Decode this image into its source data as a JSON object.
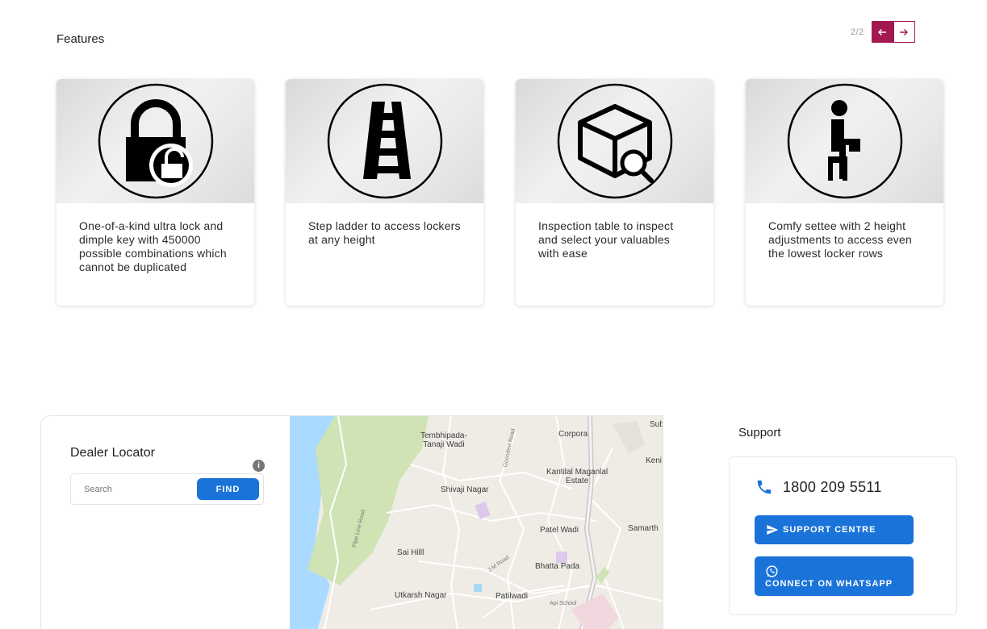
{
  "features": {
    "title": "Features",
    "pager": {
      "count": "2/2",
      "prev_icon": "arrow-left-icon",
      "next_icon": "arrow-right-icon"
    },
    "cards": [
      {
        "icon": "padlock-key-icon",
        "text": "One-of-a-kind ultra lock and dimple key with 450000 possible combinations which cannot be duplicated"
      },
      {
        "icon": "step-ladder-icon",
        "text": "Step ladder to access lockers at any height"
      },
      {
        "icon": "box-inspect-icon",
        "text": "Inspection table to inspect and select your valuables with ease"
      },
      {
        "icon": "seated-person-icon",
        "text": "Comfy settee with 2 height adjustments to access even the lowest locker rows"
      }
    ]
  },
  "dealer_locator": {
    "title": "Dealer Locator",
    "search_placeholder": "Search",
    "find_label": "FIND",
    "info_icon": "info-icon",
    "map_labels": {
      "tembhipada": "Tembhipada-\nTanaji Wadi",
      "corpora": "Corpora",
      "sub": "Sub",
      "keni": "Keni",
      "kantilal": "Kantilal Maganlal\nEstate",
      "shivaji": "Shivaji Nagar",
      "patel": "Patel Wadi",
      "samarth": "Samarth",
      "sai": "Sai Hilll",
      "bhatta": "Bhatta Pada",
      "utkarsh": "Utkarsh Nagar",
      "patilwadi": "Patilwadi",
      "goondevi": "Goondevi Road",
      "pipeline": "Pipe Line Road",
      "jm": "J M Road",
      "api": "Api School"
    }
  },
  "support": {
    "title": "Support",
    "phone_icon": "phone-icon",
    "phone": "1800 209 5511",
    "centre_label": "SUPPORT CENTRE",
    "whatsapp_label": "CONNECT ON WHATSAPP",
    "colors": {
      "button": "#1a73d9",
      "accent": "#a3184f"
    }
  }
}
